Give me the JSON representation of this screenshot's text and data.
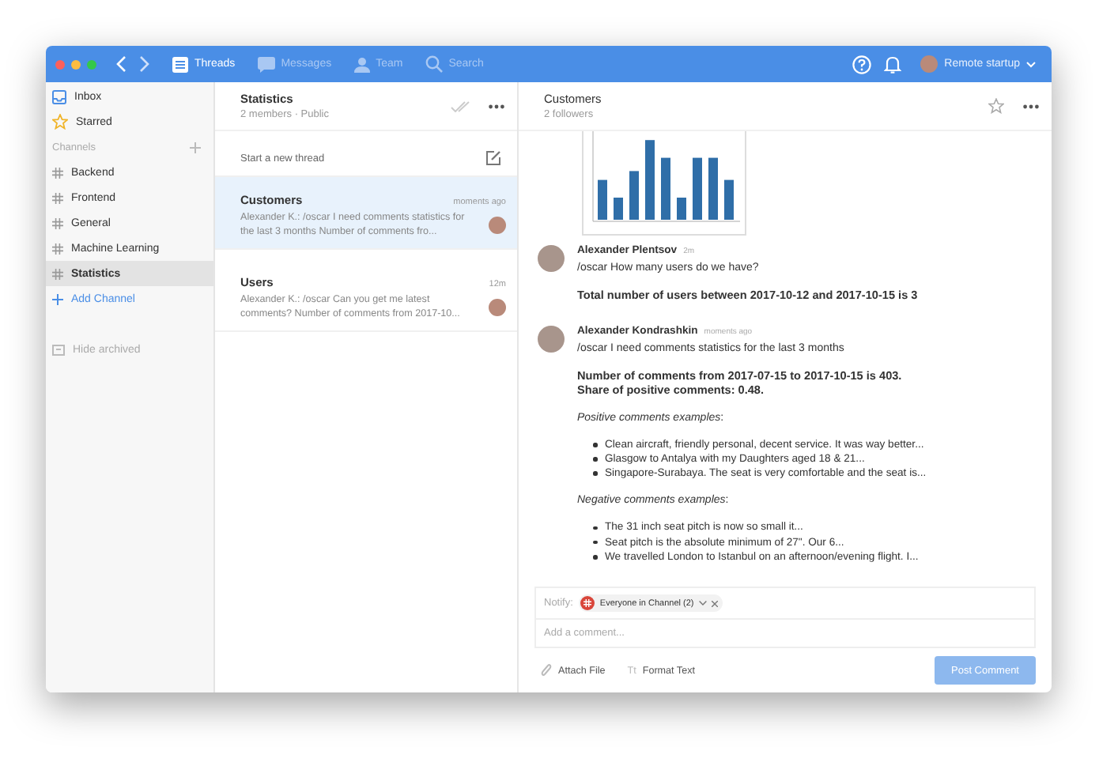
{
  "toolbar": {
    "nav": [
      {
        "label": "Threads",
        "selected": true,
        "kind": "threads"
      },
      {
        "label": "Messages",
        "selected": false,
        "kind": "messages"
      },
      {
        "label": "Team",
        "selected": false,
        "kind": "team"
      },
      {
        "label": "Search",
        "selected": false,
        "kind": "search"
      }
    ],
    "workspace": "Remote startup"
  },
  "sidebar": {
    "top": [
      {
        "label": "Inbox",
        "kind": "inbox"
      },
      {
        "label": "Starred",
        "kind": "star"
      }
    ],
    "channels_heading": "Channels",
    "channels": [
      {
        "label": "Backend",
        "selected": false
      },
      {
        "label": "Frontend",
        "selected": false
      },
      {
        "label": "General",
        "selected": false
      },
      {
        "label": "Machine Learning",
        "selected": false
      },
      {
        "label": "Statistics",
        "selected": true
      }
    ],
    "add_channel": "Add Channel",
    "hide_archived": "Hide archived"
  },
  "channel": {
    "title": "Statistics",
    "subtitle": "2 members · Public",
    "new_thread": "Start a new thread",
    "threads": [
      {
        "title": "Customers",
        "time": "moments ago",
        "preview": "Alexander K.: /oscar I need comments statistics for the last 3 months  Number of comments fro...",
        "selected": true
      },
      {
        "title": "Users",
        "time": "12m",
        "preview": "Alexander K.: /oscar Can you get me latest comments?  Number of comments from 2017-10...",
        "selected": false
      }
    ]
  },
  "thread": {
    "title": "Customers",
    "subtitle": "2 followers",
    "messages": [
      {
        "author": "Alexander Plentsov",
        "time": "2m",
        "body": [
          {
            "kind": "text",
            "text": "/oscar How many users do we have?"
          },
          {
            "kind": "bold",
            "text": "Total number of users between 2017-10-12 and 2017-10-15 is 3"
          }
        ]
      },
      {
        "author": "Alexander Kondrashkin",
        "time": "moments ago",
        "body": [
          {
            "kind": "text",
            "text": "/oscar I need comments statistics for the last 3 months"
          },
          {
            "kind": "bold",
            "text": "Number of comments from 2017-07-15 to 2017-10-15 is 403.\nShare of positive comments: 0.48."
          },
          {
            "kind": "text",
            "text": "*Positive comments examples*:"
          },
          {
            "kind": "list",
            "items": [
              "Clean aircraft, friendly personal, decent service. It was way better...",
              "Glasgow to Antalya with my Daughters aged 18 & 21...",
              "Singapore-Surabaya. The seat is very comfortable and the seat is..."
            ]
          },
          {
            "kind": "text",
            "text": "*Negative comments examples*:"
          },
          {
            "kind": "list",
            "items": [
              "The 31 inch seat pitch is now so small it...",
              "Seat pitch is the absolute minimum of 27\". Our 6...",
              "We travelled London to Istanbul on an afternoon/evening flight. I..."
            ]
          }
        ]
      }
    ],
    "notify_label": "Notify:",
    "notify_tag": "Everyone in Channel (2)",
    "comment_placeholder": "Add a comment...",
    "attach": "Attach File",
    "format_icon": "Tt",
    "format": "Format Text",
    "post": "Post Comment"
  }
}
